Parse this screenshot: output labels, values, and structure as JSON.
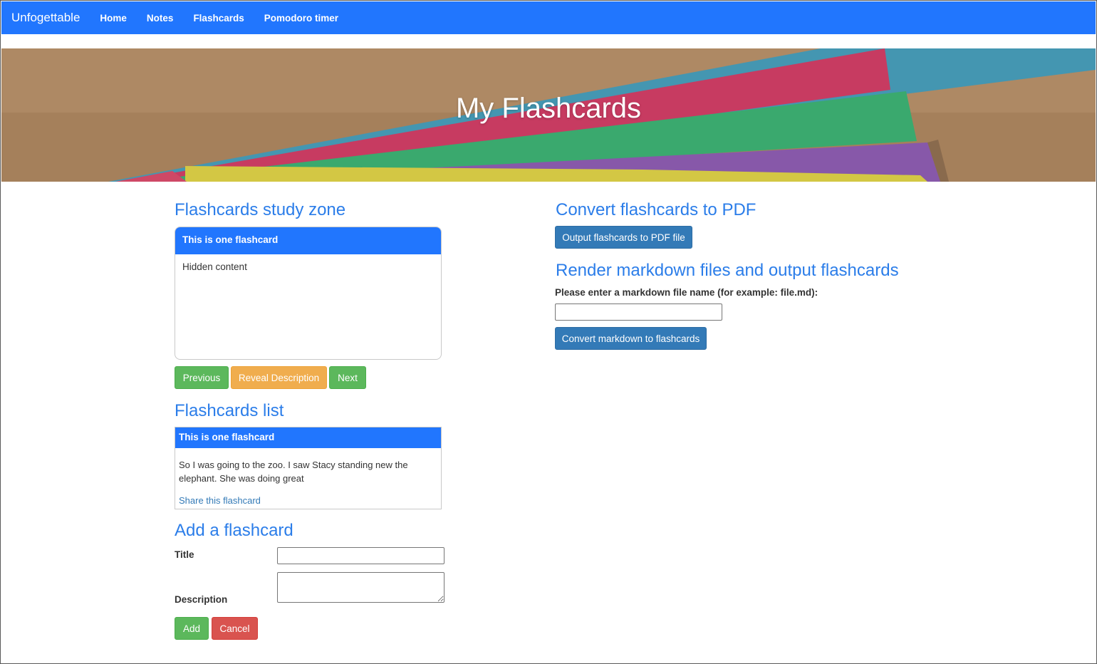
{
  "navbar": {
    "brand": "Unfogettable",
    "links": [
      "Home",
      "Notes",
      "Flashcards",
      "Pomodoro timer"
    ]
  },
  "hero": {
    "title": "My Flashcards"
  },
  "study_zone": {
    "heading": "Flashcards study zone",
    "card_title": "This is one flashcard",
    "card_body": "Hidden content",
    "buttons": {
      "previous": "Previous",
      "reveal": "Reveal Description",
      "next": "Next"
    }
  },
  "flashcards_list": {
    "heading": "Flashcards list",
    "items": [
      {
        "title": "This is one flashcard",
        "description": "So I was going to the zoo. I saw Stacy standing new the elephant. She was doing great",
        "share_label": "Share this flashcard"
      }
    ]
  },
  "add_flashcard": {
    "heading": "Add a flashcard",
    "title_label": "Title",
    "title_value": "",
    "description_label": "Description",
    "description_value": "",
    "add_label": "Add",
    "cancel_label": "Cancel"
  },
  "pdf_section": {
    "heading": "Convert flashcards to PDF",
    "button_label": "Output flashcards to PDF file"
  },
  "markdown_section": {
    "heading": "Render markdown files and output flashcards",
    "input_label": "Please enter a markdown file name (for example: file.md):",
    "input_value": "",
    "button_label": "Convert markdown to flashcards"
  },
  "colors": {
    "navbar": "#2176fe",
    "heading": "#2b7de9",
    "success": "#5cb85c",
    "warning": "#f0ad4e",
    "danger": "#d9534f",
    "primary": "#337ab7"
  }
}
